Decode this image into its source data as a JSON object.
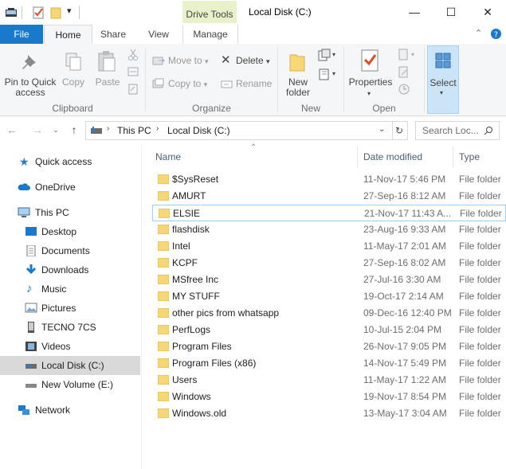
{
  "window": {
    "title": "Local Disk (C:)",
    "context_tab": "Drive Tools",
    "controls": {
      "minimize": "—",
      "maximize": "☐",
      "close": "✕"
    }
  },
  "ribbon_tabs": [
    "File",
    "Home",
    "Share",
    "View",
    "Manage"
  ],
  "ribbon": {
    "clipboard": {
      "label": "Clipboard",
      "pin_label": "Pin to Quick\naccess",
      "copy": "Copy",
      "paste": "Paste"
    },
    "organize": {
      "label": "Organize",
      "move_to": "Move to",
      "copy_to": "Copy to",
      "delete": "Delete",
      "rename": "Rename"
    },
    "new": {
      "label": "New",
      "new_folder": "New\nfolder"
    },
    "open": {
      "label": "Open",
      "properties": "Properties"
    },
    "select": {
      "label": "Select"
    }
  },
  "address": {
    "crumbs": [
      "This PC",
      "Local Disk (C:)"
    ],
    "search_placeholder": "Search Loc..."
  },
  "nav_pane": {
    "quick_access": "Quick access",
    "onedrive": "OneDrive",
    "this_pc": "This PC",
    "desktop": "Desktop",
    "documents": "Documents",
    "downloads": "Downloads",
    "music": "Music",
    "pictures": "Pictures",
    "tecno": "TECNO 7CS",
    "videos": "Videos",
    "local_disk": "Local Disk (C:)",
    "new_volume": "New Volume (E:)",
    "network": "Network"
  },
  "columns": {
    "name": "Name",
    "date": "Date modified",
    "type": "Type"
  },
  "files": [
    {
      "name": "$SysReset",
      "date": "11-Nov-17 5:46 PM",
      "type": "File folder"
    },
    {
      "name": "AMURT",
      "date": "27-Sep-16 8:12 AM",
      "type": "File folder"
    },
    {
      "name": "ELSIE",
      "date": "21-Nov-17 11:43 A...",
      "type": "File folder"
    },
    {
      "name": "flashdisk",
      "date": "23-Aug-16 9:33 AM",
      "type": "File folder"
    },
    {
      "name": "Intel",
      "date": "11-May-17 2:01 AM",
      "type": "File folder"
    },
    {
      "name": "KCPF",
      "date": "27-Sep-16 8:02 AM",
      "type": "File folder"
    },
    {
      "name": "MSfree Inc",
      "date": "27-Jul-16 3:30 AM",
      "type": "File folder"
    },
    {
      "name": "MY STUFF",
      "date": "19-Oct-17 2:14 AM",
      "type": "File folder"
    },
    {
      "name": "other pics from whatsapp",
      "date": "09-Dec-16 12:40 PM",
      "type": "File folder"
    },
    {
      "name": "PerfLogs",
      "date": "10-Jul-15 2:04 PM",
      "type": "File folder"
    },
    {
      "name": "Program Files",
      "date": "26-Nov-17 9:05 PM",
      "type": "File folder"
    },
    {
      "name": "Program Files (x86)",
      "date": "14-Nov-17 5:49 PM",
      "type": "File folder"
    },
    {
      "name": "Users",
      "date": "11-May-17 1:22 AM",
      "type": "File folder"
    },
    {
      "name": "Windows",
      "date": "19-Nov-17 8:54 PM",
      "type": "File folder"
    },
    {
      "name": "Windows.old",
      "date": "13-May-17 3:04 AM",
      "type": "File folder"
    }
  ],
  "colors": {
    "accent": "#1979ca",
    "folder": "#f7d675",
    "drive_tools": "#e8f1c9",
    "selection_border": "#99d1ff"
  }
}
